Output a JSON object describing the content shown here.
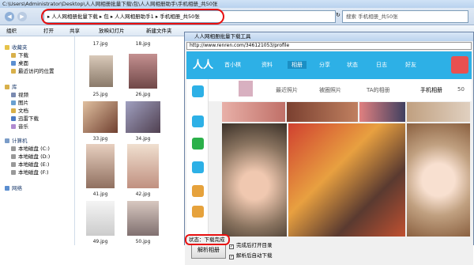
{
  "explorer": {
    "title": "C:\\Users\\Administrator\\Desktop\\人人网相册批量下载\\包\\人人网相册助手\\手机相册_共50张",
    "address_path": [
      "人人网相册批量下载",
      "包",
      "人人网相册助手1",
      "手机相册_共50张"
    ],
    "search_placeholder": "搜索 手机相册_共50张",
    "toolbar": {
      "organize": "组织",
      "open": "打开",
      "share": "共享",
      "slideshow": "放映幻灯片",
      "new_folder": "新建文件夹"
    },
    "nav": {
      "favorites": "收藏夹",
      "downloads": "下载",
      "desktop": "桌面",
      "recent": "最近访问的位置",
      "libraries": "库",
      "videos": "视频",
      "pictures": "图片",
      "documents": "文档",
      "thunder": "迅雷下载",
      "music": "音乐",
      "computer": "计算机",
      "disk_c": "本地磁盘 (C:)",
      "disk_d": "本地磁盘 (D:)",
      "disk_e": "本地磁盘 (E:)",
      "disk_f": "本地磁盘 (F:)",
      "network": "网络"
    },
    "files": [
      "17.jpg",
      "18.jpg",
      "25.jpg",
      "26.jpg",
      "33.jpg",
      "34.jpg",
      "41.jpg",
      "42.jpg",
      "49.jpg",
      "50.jpg"
    ]
  },
  "dialog": {
    "title": "人人网相册批量下载工具",
    "url": "http://www.renren.com/346121053/profile",
    "renren_nav": [
      "首小棋",
      "资料",
      "相册",
      "分享",
      "状态",
      "日志",
      "好友"
    ],
    "tabs": [
      "最近照片",
      "被圈照片",
      "TA的相册",
      "手机相册",
      "50"
    ],
    "parse_button": "解析相册",
    "check_open": "完成后打开目录",
    "check_shutdown": "解析后自动下载",
    "status": "状态：下载完成"
  }
}
